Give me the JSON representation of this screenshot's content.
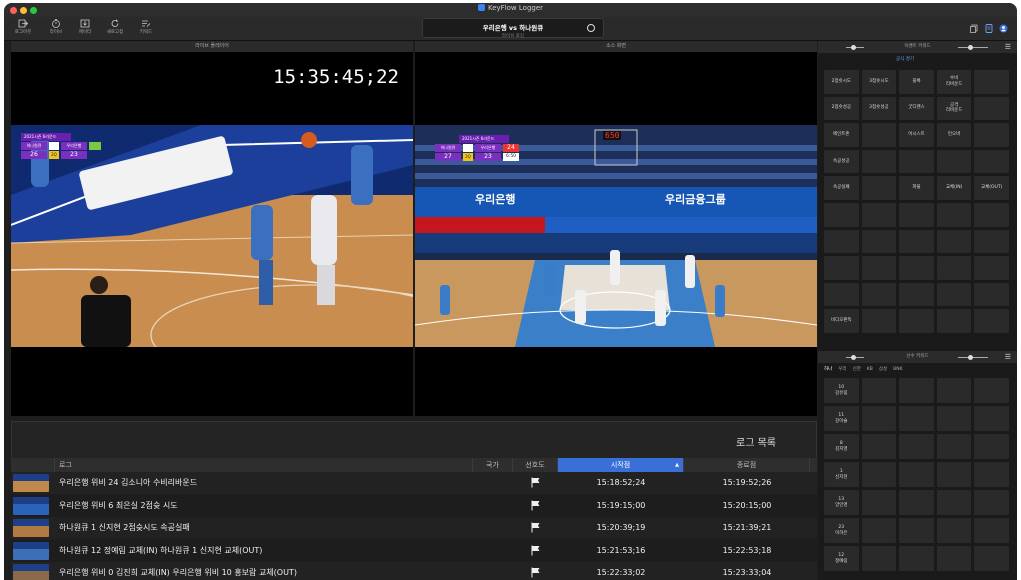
{
  "window": {
    "title": "KeyFlow Logger"
  },
  "toolbar": {
    "buttons": [
      {
        "label": "로그아웃",
        "icon": "logout-icon"
      },
      {
        "label": "라이브",
        "icon": "timer-icon"
      },
      {
        "label": "에이터",
        "icon": "import-icon"
      },
      {
        "label": "새로고침",
        "icon": "refresh-icon"
      },
      {
        "label": "키워드",
        "icon": "keyword-edit-icon"
      }
    ],
    "match_title": "우리은행 vs 하나원큐",
    "match_sub": "라이브 로깅"
  },
  "panels": {
    "live_player": "라이브 플레이어",
    "source_screen": "소스 화면"
  },
  "live": {
    "timecode": "15:35:45;22",
    "scorebug": {
      "round": "2021시즌 6라운드",
      "team1": "하나원큐",
      "team2": "우리은행",
      "score1": "26",
      "period": "2Q",
      "score2": "23"
    }
  },
  "source": {
    "scorebug": {
      "round": "2021시즌 6라운드",
      "team1": "하나원큐",
      "team2": "우리은행",
      "score1": "27",
      "period": "2Q",
      "score2": "23",
      "shot": "24",
      "clock": "6:50"
    },
    "shot_clock": "650",
    "banner1": "우리은행",
    "banner2": "우리금융그룹"
  },
  "logs": {
    "title": "로그 목록",
    "columns": {
      "log": "로그",
      "country": "국가",
      "priority": "선호도",
      "start": "시작점",
      "end": "종료점"
    },
    "rows": [
      {
        "text": "우리은행 위비 24 김소니아 수비리바운드",
        "start": "15:18:52;24",
        "end": "15:19:52;26"
      },
      {
        "text": "우리은행 위비 6 최은실 2점슛 시도",
        "start": "15:19:15;00",
        "end": "15:20:15;00"
      },
      {
        "text": "하나원큐 1 신지현 2점슛시도 속공실패",
        "start": "15:20:39;19",
        "end": "15:21:39;21"
      },
      {
        "text": "하나원큐 12 정예림 교체(IN) 하나원큐 1 신지현 교체(OUT)",
        "start": "15:21:53;16",
        "end": "15:22:53;18"
      },
      {
        "text": "우리은행 위비 0 김진희 교체(IN) 우리은행 위비 10 홍보람 교체(OUT)",
        "start": "15:22:33;02",
        "end": "15:23:33;04"
      }
    ]
  },
  "event_keywords": {
    "title": "이벤트 키워드",
    "tab": "공식 경기",
    "cells": [
      [
        "2점슛시도",
        "3점슛시도",
        "블록",
        "수비\n리바운드",
        ""
      ],
      [
        "2점슛성공",
        "3점슛성공",
        "굿디펜스",
        "공격\n리바운드",
        ""
      ],
      [
        "페인트존",
        "",
        "어시스트",
        "턴오버",
        ""
      ],
      [
        "속공성공",
        "",
        "",
        "",
        ""
      ],
      [
        "속공실패",
        "",
        "파울",
        "교체(IN)",
        "교체(OUT)"
      ],
      [
        "",
        "",
        "",
        "",
        ""
      ],
      [
        "",
        "",
        "",
        "",
        ""
      ],
      [
        "",
        "",
        "",
        "",
        ""
      ],
      [
        "",
        "",
        "",
        "",
        ""
      ],
      [
        "비디오판독",
        "",
        "",
        "",
        ""
      ]
    ]
  },
  "player_keywords": {
    "title": "선수 키워드",
    "tabs": [
      "하나",
      "우리",
      "신한",
      "KB",
      "삼성",
      "BNK"
    ],
    "players": [
      {
        "num": "10",
        "name": "강유림"
      },
      {
        "num": "11",
        "name": "강이슬"
      },
      {
        "num": "8",
        "name": "김지영"
      },
      {
        "num": "1",
        "name": "신지현"
      },
      {
        "num": "13",
        "name": "양인영"
      },
      {
        "num": "23",
        "name": "이하은"
      },
      {
        "num": "12",
        "name": "정예림"
      }
    ]
  },
  "colors": {
    "accent": "#3a6fd8",
    "court": "#c78f4e",
    "purple": "#7b2fbe"
  }
}
